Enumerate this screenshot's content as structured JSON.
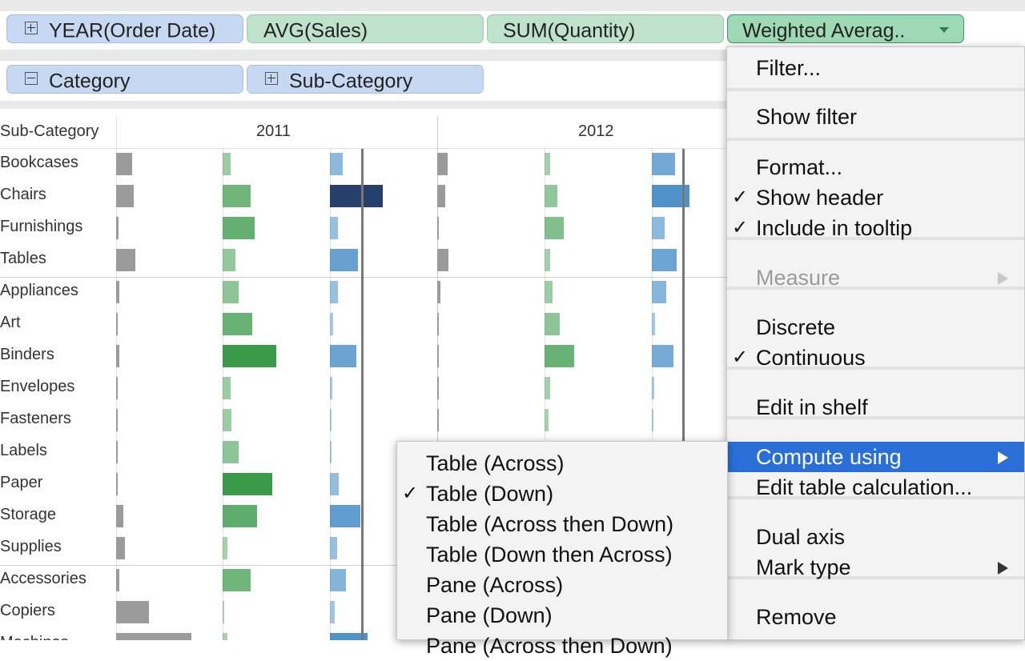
{
  "columns_shelf": {
    "pills": [
      {
        "label": "YEAR(Order Date)"
      },
      {
        "label": "AVG(Sales)"
      },
      {
        "label": "SUM(Quantity)"
      },
      {
        "label": "Weighted Averag.."
      }
    ]
  },
  "rows_shelf": {
    "pills": [
      {
        "label": "Category"
      },
      {
        "label": "Sub-Category"
      }
    ]
  },
  "viz": {
    "row_header": "Sub-Category",
    "columns": [
      "2011",
      "2012"
    ],
    "rows": [
      "Bookcases",
      "Chairs",
      "Furnishings",
      "Tables",
      "Appliances",
      "Art",
      "Binders",
      "Envelopes",
      "Fasteners",
      "Labels",
      "Paper",
      "Storage",
      "Supplies",
      "Accessories",
      "Copiers",
      "Machines"
    ],
    "colors": {
      "grey": "#9b9b9b",
      "green": "#3a9a4a",
      "blue": "#2f7fbf",
      "navy": "#25406b",
      "refline": "#777777"
    },
    "bars_2011": {
      "avg_sales": [
        0.38,
        0.42,
        0.05,
        0.46,
        0.08,
        0.02,
        0.08,
        0.02,
        0.02,
        0.02,
        0.02,
        0.18,
        0.22,
        0.08,
        0.78,
        1.8
      ],
      "sum_quantity": [
        0.2,
        0.67,
        0.77,
        0.3,
        0.38,
        0.72,
        1.28,
        0.2,
        0.22,
        0.38,
        1.2,
        0.82,
        0.12,
        0.67,
        0.04,
        0.12
      ],
      "weighted": [
        0.3,
        1.26,
        0.2,
        0.67,
        0.2,
        0.08,
        0.63,
        0.06,
        0.02,
        0.04,
        0.22,
        0.73,
        0.18,
        0.38,
        0.12,
        0.9
      ]
    },
    "bars_2012": {
      "avg_sales": [
        0.25,
        0.2,
        0.03,
        0.27,
        0.08,
        0.02,
        0.02,
        0.02,
        0.02,
        0.02,
        0.02,
        0.02,
        0.02,
        0.02,
        0.02,
        0.02
      ],
      "sum_quantity": [
        0.13,
        0.31,
        0.46,
        0.13,
        0.2,
        0.36,
        0.72,
        0.13,
        0.1,
        0.1,
        0.1,
        0.1,
        0.1,
        0.1,
        0.1,
        0.1
      ],
      "weighted": [
        0.55,
        0.9,
        0.3,
        0.6,
        0.35,
        0.08,
        0.52,
        0.06,
        0.02,
        0.02,
        0.02,
        0.02,
        0.02,
        0.02,
        0.02,
        0.02
      ]
    }
  },
  "context_menu": {
    "items": [
      {
        "label": "Filter..."
      },
      {
        "label": "Show filter"
      },
      {
        "label": "Format..."
      },
      {
        "label": "Show header",
        "checked": true
      },
      {
        "label": "Include in tooltip",
        "checked": true
      },
      {
        "label": "Measure",
        "disabled": true,
        "submenu": true
      },
      {
        "label": "Discrete"
      },
      {
        "label": "Continuous",
        "checked": true
      },
      {
        "label": "Edit in shelf"
      },
      {
        "label": "Compute using",
        "highlighted": true,
        "submenu": true
      },
      {
        "label": "Edit table calculation..."
      },
      {
        "label": "Dual axis"
      },
      {
        "label": "Mark type",
        "submenu": true
      },
      {
        "label": "Remove"
      }
    ]
  },
  "submenu": {
    "items": [
      {
        "label": "Table (Across)"
      },
      {
        "label": "Table (Down)",
        "checked": true
      },
      {
        "label": "Table (Across then Down)"
      },
      {
        "label": "Table (Down then Across)"
      },
      {
        "label": "Pane (Across)"
      },
      {
        "label": "Pane (Down)"
      },
      {
        "label": "Pane (Across then Down)"
      }
    ]
  },
  "check_glyph": "✓"
}
